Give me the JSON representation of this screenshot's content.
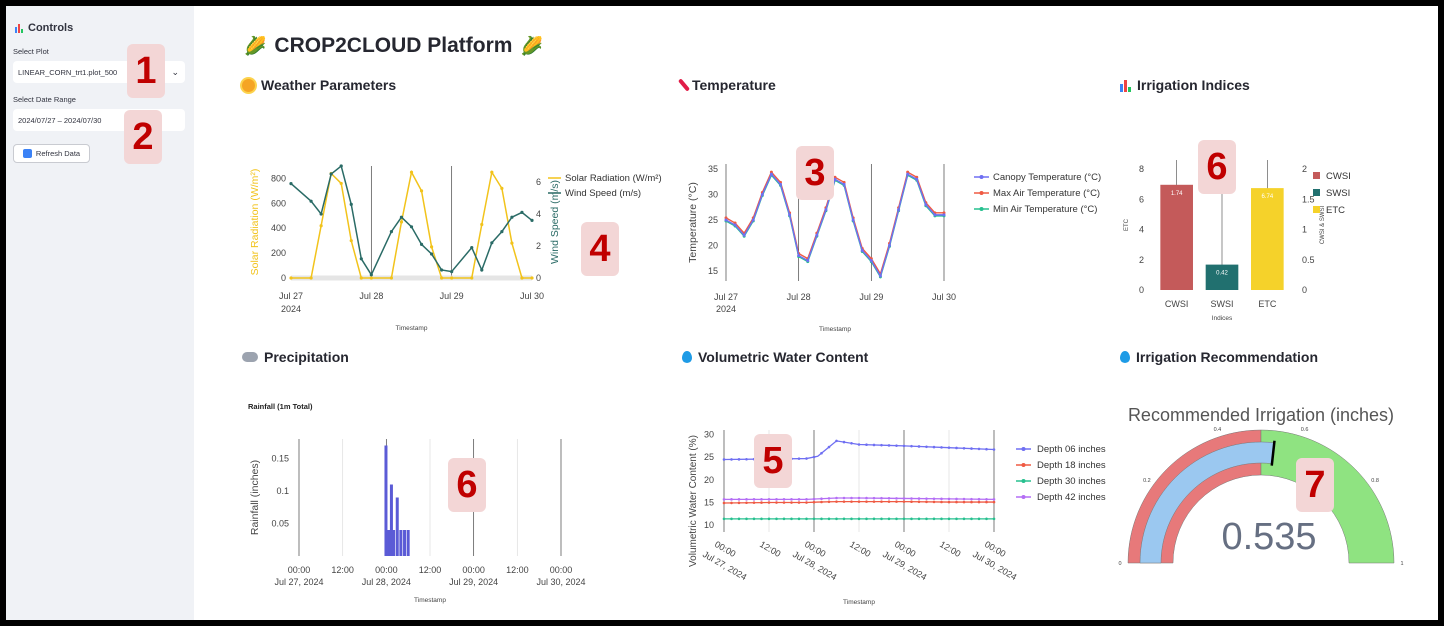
{
  "sidebar": {
    "title": "Controls",
    "select_plot_label": "Select Plot",
    "select_plot_value": "LINEAR_CORN_trt1.plot_500",
    "date_range_label": "Select Date Range",
    "date_range_value": "2024/07/27 – 2024/07/30",
    "refresh_label": "Refresh Data"
  },
  "main": {
    "title": "CROP2CLOUD Platform",
    "sections": {
      "weather": "Weather Parameters",
      "temperature": "Temperature",
      "irrigation_indices": "Irrigation Indices",
      "precipitation": "Precipitation",
      "vwc": "Volumetric Water Content",
      "irrigation_rec": "Irrigation Recommendation"
    }
  },
  "badges": [
    "1",
    "2",
    "3",
    "4",
    "5",
    "6",
    "6",
    "7"
  ],
  "chart_data": [
    {
      "id": "weather",
      "type": "line",
      "xlabel": "Timestamp",
      "ylabel": "Solar Radiation (W/m²)",
      "y2label": "Wind Speed (m/s)",
      "x_ticks": [
        "Jul 27",
        "Jul 28",
        "Jul 29",
        "Jul 30"
      ],
      "x_tick_sub": "2024",
      "ylim": [
        0,
        900
      ],
      "y_ticks": [
        0,
        200,
        400,
        600,
        800
      ],
      "y2lim": [
        0,
        7
      ],
      "y2_ticks": [
        0,
        2,
        4,
        6
      ],
      "legend": [
        "Solar Radiation (W/m²)",
        "Wind Speed (m/s)"
      ],
      "colors": {
        "solar": "#f2c31b",
        "wind": "#2a6b66"
      },
      "x_hours": [
        0,
        6,
        9,
        12,
        15,
        18,
        21,
        24,
        30,
        33,
        36,
        39,
        42,
        45,
        48,
        54,
        57,
        60,
        63,
        66,
        69,
        72
      ],
      "solar": [
        0,
        0,
        420,
        840,
        760,
        300,
        0,
        0,
        0,
        450,
        850,
        700,
        250,
        0,
        0,
        0,
        430,
        850,
        720,
        280,
        0,
        0
      ],
      "wind": [
        5.9,
        4.8,
        4.0,
        6.5,
        7.0,
        4.6,
        1.2,
        0.2,
        2.9,
        3.8,
        3.2,
        2.1,
        1.5,
        0.5,
        0.4,
        1.9,
        0.5,
        2.2,
        2.9,
        3.8,
        4.1,
        3.6
      ]
    },
    {
      "id": "temperature",
      "type": "line",
      "xlabel": "Timestamp",
      "ylabel": "Temperature (°C)",
      "x_ticks": [
        "Jul 27",
        "Jul 28",
        "Jul 29",
        "Jul 30"
      ],
      "x_tick_sub": "2024",
      "ylim": [
        13,
        36
      ],
      "y_ticks": [
        15,
        20,
        25,
        30,
        35
      ],
      "legend": [
        "Canopy Temperature (°C)",
        "Max Air Temperature (°C)",
        "Min Air Temperature (°C)"
      ],
      "colors": {
        "canopy": "#6f6ff2",
        "max": "#ef5a43",
        "min": "#27c08f"
      },
      "x_hours": [
        0,
        3,
        6,
        9,
        12,
        15,
        18,
        21,
        24,
        27,
        30,
        33,
        36,
        39,
        42,
        45,
        48,
        51,
        54,
        57,
        60,
        63,
        66,
        69,
        72
      ],
      "values": [
        25,
        24,
        22,
        25,
        30,
        34,
        32,
        26,
        18,
        17,
        22,
        27,
        33,
        32,
        25,
        19,
        17,
        14,
        20,
        27,
        34,
        33,
        28,
        26,
        26
      ]
    },
    {
      "id": "irrigation_indices",
      "type": "bar",
      "xlabel": "Indices",
      "ylabel": "ETC",
      "y2label": "CWSI & SWSI",
      "categories": [
        "CWSI",
        "SWSI",
        "ETC"
      ],
      "values": [
        1.74,
        0.42,
        6.74
      ],
      "labels": [
        "1.74",
        "0.42",
        "6.74"
      ],
      "ylim": [
        0,
        8.6
      ],
      "y_ticks": [
        0,
        2,
        4,
        6,
        8
      ],
      "y2lim": [
        0,
        2.15
      ],
      "y2_ticks": [
        0,
        0.5,
        1,
        1.5,
        2
      ],
      "legend": [
        "CWSI",
        "SWSI",
        "ETC"
      ],
      "colors": [
        "#c45a5a",
        "#21706f",
        "#f5d22a"
      ]
    },
    {
      "id": "precipitation",
      "type": "bar",
      "title": "Rainfall (1m Total)",
      "xlabel": "Timestamp",
      "ylabel": "Rainfall (inches)",
      "x_ticks": [
        "00:00",
        "12:00",
        "00:00",
        "12:00",
        "00:00",
        "12:00",
        "00:00"
      ],
      "x_tick_sub": [
        "Jul 27, 2024",
        "",
        "Jul 28, 2024",
        "",
        "Jul 29, 2024",
        "",
        "Jul 30, 2024"
      ],
      "ylim": [
        0,
        0.18
      ],
      "y_ticks": [
        0.05,
        0.1,
        0.15
      ],
      "color": "#5b5bd6",
      "x_hours": [
        23.9,
        24.4,
        24.9,
        25.4,
        26.0,
        27.0,
        28.0,
        29.0,
        30.0
      ],
      "values": [
        0.17,
        0.04,
        0.04,
        0.11,
        0.04,
        0.09,
        0.04,
        0.04,
        0.04
      ]
    },
    {
      "id": "vwc",
      "type": "line",
      "xlabel": "Timestamp",
      "ylabel": "Volumetric Water Content (%)",
      "x_ticks": [
        "00:00",
        "12:00",
        "00:00",
        "12:00",
        "00:00",
        "12:00",
        "00:00"
      ],
      "x_tick_sub": [
        "Jul 27, 2024",
        "",
        "Jul 28, 2024",
        "",
        "Jul 29, 2024",
        "",
        "Jul 30, 2024"
      ],
      "ylim": [
        8.5,
        31
      ],
      "y_ticks": [
        10,
        15,
        20,
        25,
        30
      ],
      "legend": [
        "Depth 06 inches",
        "Depth 18 inches",
        "Depth 30 inches",
        "Depth 42 inches"
      ],
      "colors": [
        "#6f6ff2",
        "#ef5a43",
        "#27c08f",
        "#b46ef5"
      ],
      "x_hours": [
        0,
        12,
        22,
        25,
        30,
        36,
        48,
        60,
        72
      ],
      "series": [
        [
          24.5,
          24.6,
          24.7,
          25.2,
          28.6,
          27.8,
          27.5,
          27.1,
          26.7
        ],
        [
          14.9,
          15.0,
          15.0,
          15.1,
          15.2,
          15.2,
          15.2,
          15.1,
          15.1
        ],
        [
          11.4,
          11.4,
          11.4,
          11.4,
          11.4,
          11.4,
          11.4,
          11.4,
          11.4
        ],
        [
          15.7,
          15.7,
          15.7,
          15.8,
          16.0,
          16.0,
          15.9,
          15.8,
          15.7
        ]
      ]
    },
    {
      "id": "irrigation_rec",
      "type": "gauge",
      "title": "Recommended Irrigation (inches)",
      "value": 0.535,
      "value_label": "0.535",
      "range": [
        0,
        1
      ],
      "ticks": [
        "0",
        "0.2",
        "0.4",
        "0.6",
        "0.8",
        "1"
      ],
      "threshold_split": 0.5,
      "colors": {
        "low": "#e7797a",
        "high": "#8fe381",
        "bar": "#9bc8f0",
        "needle": "#000000"
      }
    }
  ]
}
